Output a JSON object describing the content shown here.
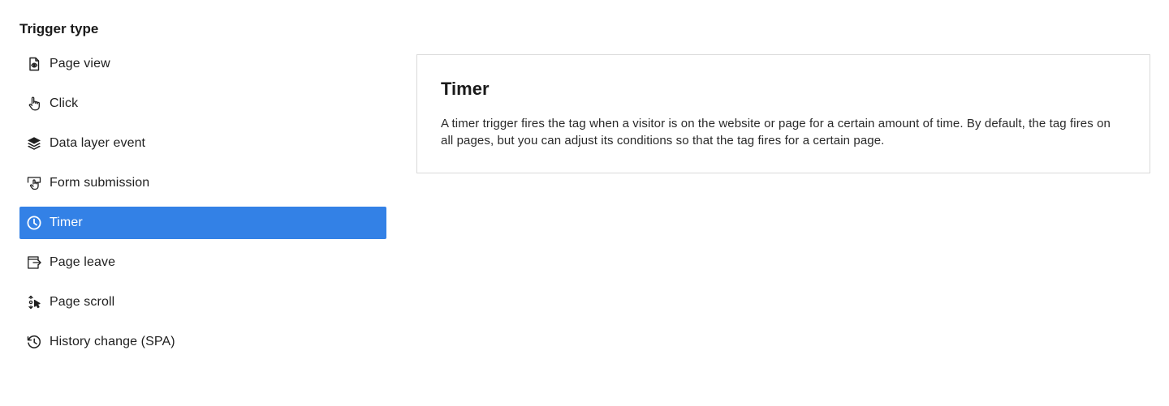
{
  "trigger_section": {
    "title": "Trigger type",
    "items": [
      {
        "label": "Page view",
        "icon": "page-view-icon",
        "selected": false
      },
      {
        "label": "Click",
        "icon": "hand-pointer-icon",
        "selected": false
      },
      {
        "label": "Data layer event",
        "icon": "layers-icon",
        "selected": false
      },
      {
        "label": "Form submission",
        "icon": "form-submission-icon",
        "selected": false
      },
      {
        "label": "Timer",
        "icon": "clock-icon",
        "selected": true
      },
      {
        "label": "Page leave",
        "icon": "page-leave-icon",
        "selected": false
      },
      {
        "label": "Page scroll",
        "icon": "page-scroll-icon",
        "selected": false
      },
      {
        "label": "History change (SPA)",
        "icon": "history-icon",
        "selected": false
      }
    ]
  },
  "detail": {
    "title": "Timer",
    "description": "A timer trigger fires the tag when a visitor is on the website or page for a certain amount of time. By default, the tag fires on all pages, but you can adjust its conditions so that the tag fires for a certain page."
  },
  "colors": {
    "selected_background": "#3381e6",
    "selected_text": "#ffffff",
    "text": "#1f1f1f",
    "card_border": "#d9d9d9"
  }
}
